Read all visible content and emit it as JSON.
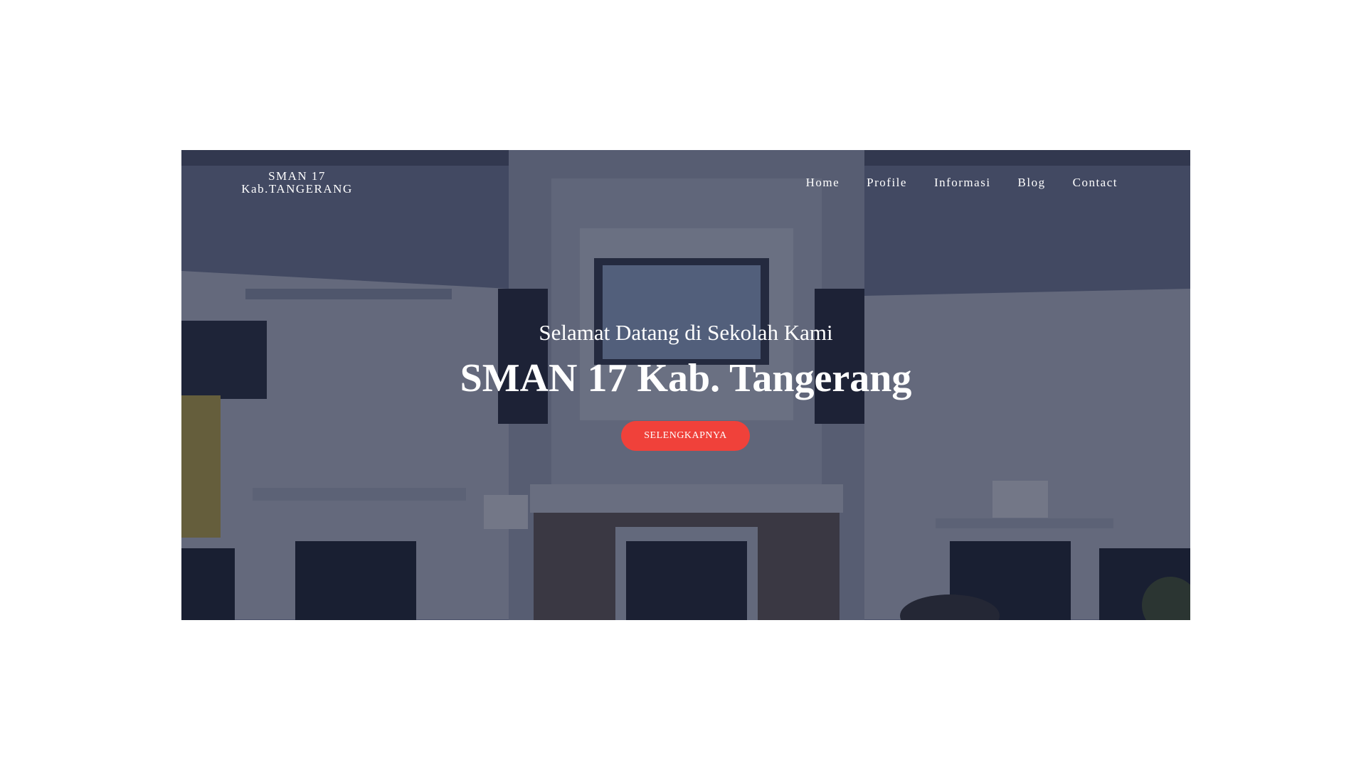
{
  "brand": {
    "line1": "SMAN 17",
    "line2": "Kab.TANGERANG"
  },
  "nav": {
    "items": [
      {
        "label": "Home"
      },
      {
        "label": "Profile"
      },
      {
        "label": "Informasi"
      },
      {
        "label": "Blog"
      },
      {
        "label": "Contact"
      }
    ]
  },
  "hero": {
    "subtitle": "Selamat Datang di Sekolah Kami",
    "title": "SMAN 17 Kab. Tangerang",
    "cta_label": "SELENGKAPNYA",
    "background_image": "school-building-photo",
    "overlay_color": "#121832",
    "cta_color": "#f0413a"
  }
}
